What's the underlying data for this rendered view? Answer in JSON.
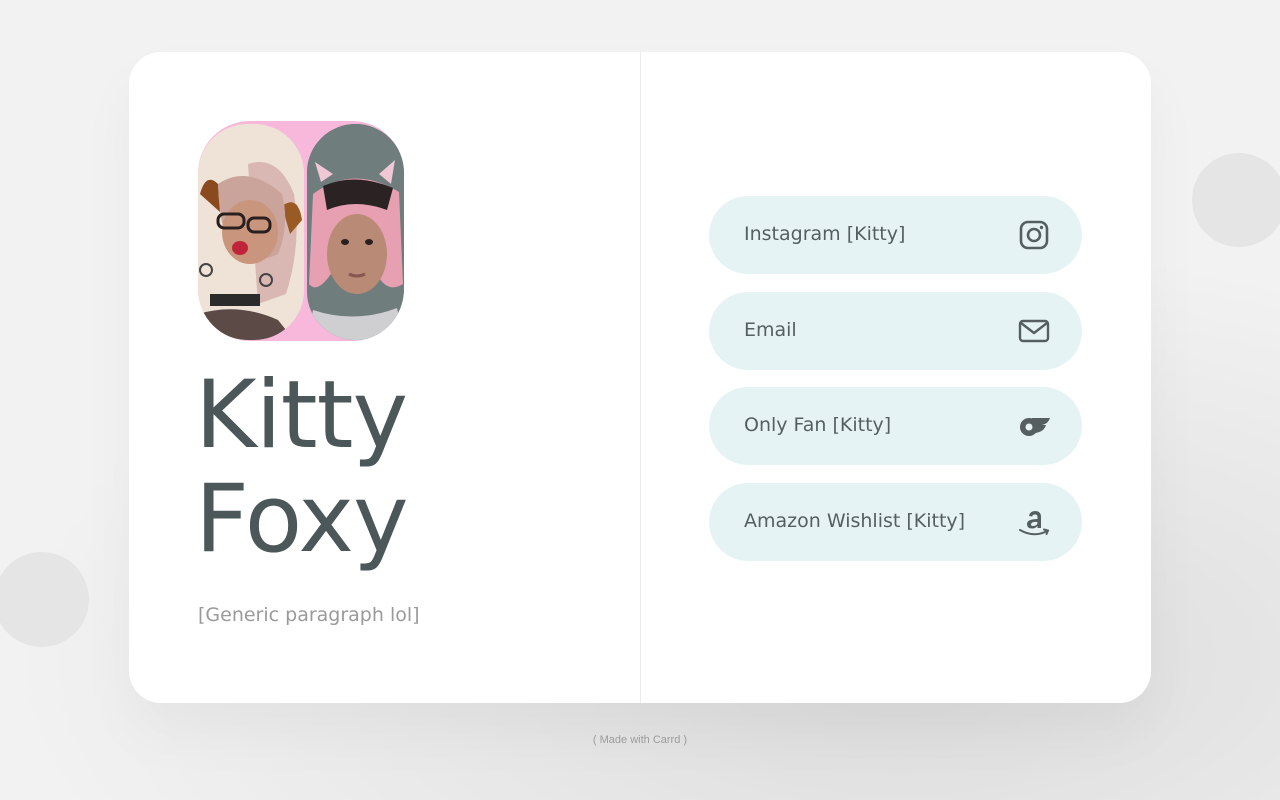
{
  "profile": {
    "title_line1": "Kitty",
    "title_line2": "Foxy",
    "paragraph": "[Generic paragraph lol]"
  },
  "links": [
    {
      "label": "Instagram [Kitty]",
      "icon": "instagram-icon"
    },
    {
      "label": "Email",
      "icon": "envelope-icon"
    },
    {
      "label": "Only Fan [Kitty]",
      "icon": "onlyfans-icon"
    },
    {
      "label": "Amazon Wishlist [Kitty]",
      "icon": "amazon-icon"
    }
  ],
  "footer": {
    "label": "( Made with Carrd )"
  },
  "colors": {
    "title": "#4b5759",
    "link_bg": "#e6f3f4",
    "avatar_bg": "#f8b8dc"
  }
}
